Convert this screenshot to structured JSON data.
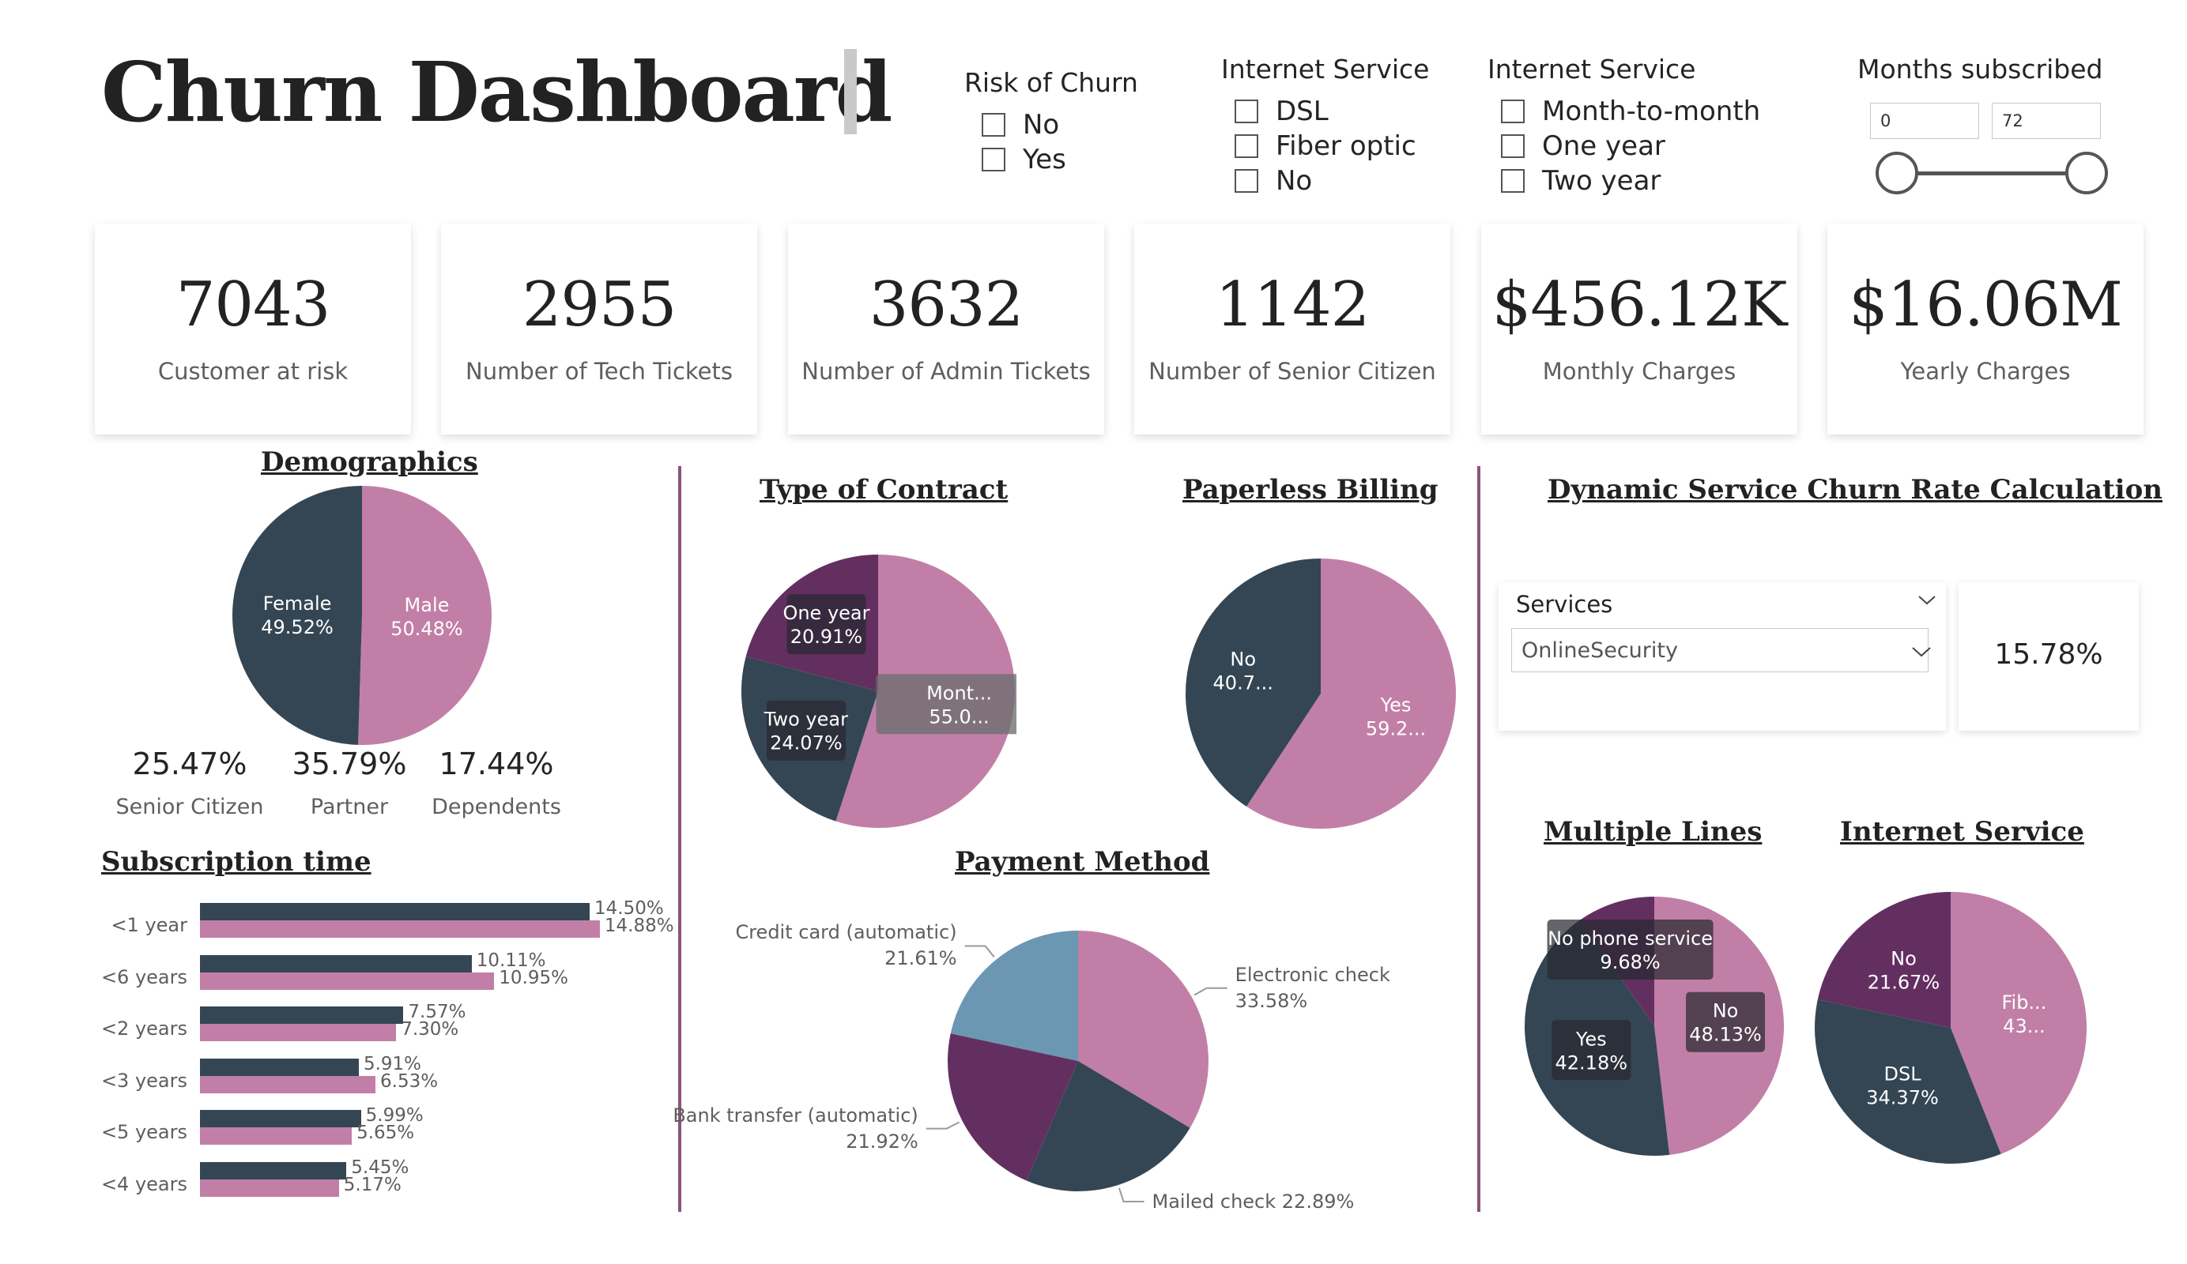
{
  "title": "Churn Dashboard",
  "slicers": {
    "risk": {
      "title": "Risk of Churn",
      "options": [
        "No",
        "Yes"
      ]
    },
    "internet": {
      "title": "Internet Service",
      "options": [
        "DSL",
        "Fiber optic",
        "No"
      ]
    },
    "contract": {
      "title": "Internet Service",
      "options": [
        "Month-to-month",
        "One year",
        "Two year"
      ]
    },
    "months": {
      "title": "Months subscribed",
      "min": "0",
      "max": "72",
      "range_fraction": [
        0,
        1
      ]
    }
  },
  "kpis": [
    {
      "value": "7043",
      "label": "Customer at risk"
    },
    {
      "value": "2955",
      "label": "Number of Tech Tickets"
    },
    {
      "value": "3632",
      "label": "Number of Admin Tickets"
    },
    {
      "value": "1142",
      "label": "Number of Senior Citizen"
    },
    {
      "value": "$456.12K",
      "label": "Monthly Charges"
    },
    {
      "value": "$16.06M",
      "label": "Yearly Charges"
    }
  ],
  "demographics": {
    "title": "Demographics",
    "stats": [
      {
        "value": "25.47%",
        "label": "Senior Citizen"
      },
      {
        "value": "35.79%",
        "label": "Partner"
      },
      {
        "value": "17.44%",
        "label": "Dependents"
      }
    ]
  },
  "subscription": {
    "title": "Subscription time"
  },
  "sections": {
    "contract": "Type of Contract",
    "paperless": "Paperless Billing",
    "payment": "Payment Method",
    "dynamic": "Dynamic Service Churn Rate Calculation",
    "multiple_lines": "Multiple Lines",
    "internet_service": "Internet Service"
  },
  "services_filter": {
    "label": "Services",
    "selected": "OnlineSecurity",
    "rate": "15.78%"
  },
  "colors": {
    "dark": "#344654",
    "pink": "#c17fa7",
    "purple": "#632f61",
    "blue": "#6b97b3",
    "divider": "#8a5674"
  },
  "chart_data": [
    {
      "id": "demographics",
      "type": "pie",
      "slices": [
        {
          "label": "Male",
          "value": 50.48,
          "display": "50.48%",
          "color": "#c17fa7"
        },
        {
          "label": "Female",
          "value": 49.52,
          "display": "49.52%",
          "color": "#344654"
        }
      ]
    },
    {
      "id": "subscription",
      "type": "bar",
      "orientation": "horizontal",
      "categories": [
        "<1 year",
        "<6 years",
        "<2 years",
        "<3 years",
        "<5 years",
        "<4 years"
      ],
      "series": [
        {
          "values": [
            14.5,
            10.11,
            7.57,
            5.91,
            5.99,
            5.45
          ],
          "labels": [
            "14.50%",
            "10.11%",
            "7.57%",
            "5.91%",
            "5.99%",
            "5.45%"
          ],
          "color": "#344654"
        },
        {
          "values": [
            14.88,
            10.95,
            7.3,
            6.53,
            5.65,
            5.17
          ],
          "labels": [
            "14.88%",
            "10.95%",
            "7.30%",
            "6.53%",
            "5.65%",
            "5.17%"
          ],
          "color": "#c17fa7"
        }
      ]
    },
    {
      "id": "contract",
      "type": "pie",
      "slices": [
        {
          "label": "Mont...",
          "value": 55.0,
          "display": "55.0...",
          "color": "#c17fa7"
        },
        {
          "label": "Two year",
          "value": 24.07,
          "display": "24.07%",
          "color": "#344654"
        },
        {
          "label": "One year",
          "value": 20.91,
          "display": "20.91%",
          "color": "#632f61"
        }
      ]
    },
    {
      "id": "paperless",
      "type": "pie",
      "slices": [
        {
          "label": "Yes",
          "value": 59.2,
          "display": "59.2...",
          "color": "#c17fa7"
        },
        {
          "label": "No",
          "value": 40.7,
          "display": "40.7...",
          "color": "#344654"
        }
      ]
    },
    {
      "id": "payment",
      "type": "pie",
      "slices": [
        {
          "label": "Electronic check",
          "value": 33.58,
          "display": "33.58%",
          "color": "#c17fa7"
        },
        {
          "label": "Mailed check",
          "value": 22.89,
          "display": "22.89%",
          "color": "#344654"
        },
        {
          "label": "Bank transfer (automatic)",
          "value": 21.92,
          "display": "21.92%",
          "color": "#632f61"
        },
        {
          "label": "Credit card (automatic)",
          "value": 21.61,
          "display": "21.61%",
          "color": "#6b97b3"
        }
      ]
    },
    {
      "id": "multiple_lines",
      "type": "pie",
      "slices": [
        {
          "label": "No",
          "value": 48.13,
          "display": "48.13%",
          "color": "#c17fa7"
        },
        {
          "label": "Yes",
          "value": 42.18,
          "display": "42.18%",
          "color": "#344654"
        },
        {
          "label": "No phone service",
          "value": 9.68,
          "display": "9.68%",
          "color": "#632f61"
        }
      ]
    },
    {
      "id": "internet_service",
      "type": "pie",
      "slices": [
        {
          "label": "Fib...",
          "value": 43.96,
          "display": "43...",
          "color": "#c17fa7"
        },
        {
          "label": "DSL",
          "value": 34.37,
          "display": "34.37%",
          "color": "#344654"
        },
        {
          "label": "No",
          "value": 21.67,
          "display": "21.67%",
          "color": "#632f61"
        }
      ]
    }
  ]
}
